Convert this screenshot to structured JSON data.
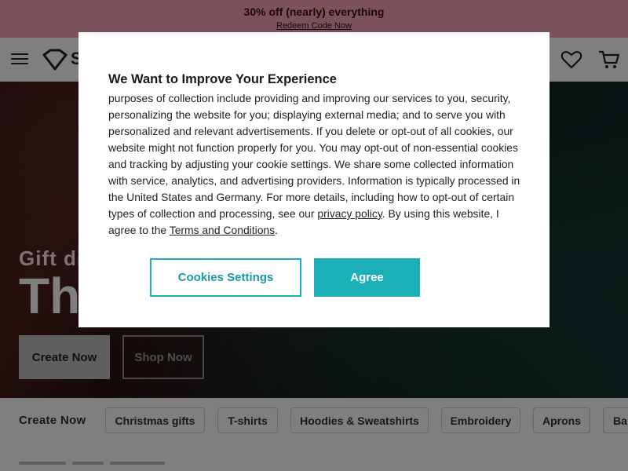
{
  "promo": {
    "title": "30% off (nearly) everything",
    "link": "Redeem Code Now"
  },
  "header": {
    "logo_text": "S",
    "icons": [
      "menu-icon",
      "heart-icon",
      "cart-icon"
    ]
  },
  "hero": {
    "subtitle": "Gift di",
    "title": "Th",
    "create_button": "Create Now",
    "shop_button": "Shop Now"
  },
  "categories": {
    "label": "Create Now",
    "chips": [
      "Christmas gifts",
      "T-shirts",
      "Hoodies & Sweatshirts",
      "Embroidery",
      "Aprons",
      "Ba"
    ]
  },
  "cookie_modal": {
    "title": "We Want to Improve Your Experience",
    "body_part1": "purposes of collection include providing and improving our services to you, security, personalizing the website for you; displaying external media; and to serve you with personalized and relevant advertisements. If you delete or opt-out of all cookies, our website might not function properly for you. You may opt-out of non-essential cookies and tracking by adjusting your cookie settings. We share some collected information with service, analytics, and advertising providers. Information is typically processed in the United States and Germany. For more details, including how to opt-out of certain types of collection and processing, see our ",
    "privacy_link": "privacy policy",
    "body_part2": ". By using this website, I agree to the ",
    "terms_link": "Terms and Conditions",
    "body_part3": ".",
    "settings_button": "Cookies Settings",
    "agree_button": "Agree"
  },
  "colors": {
    "promo_bg": "#f6a3b8",
    "accent": "#1bb0b7"
  }
}
